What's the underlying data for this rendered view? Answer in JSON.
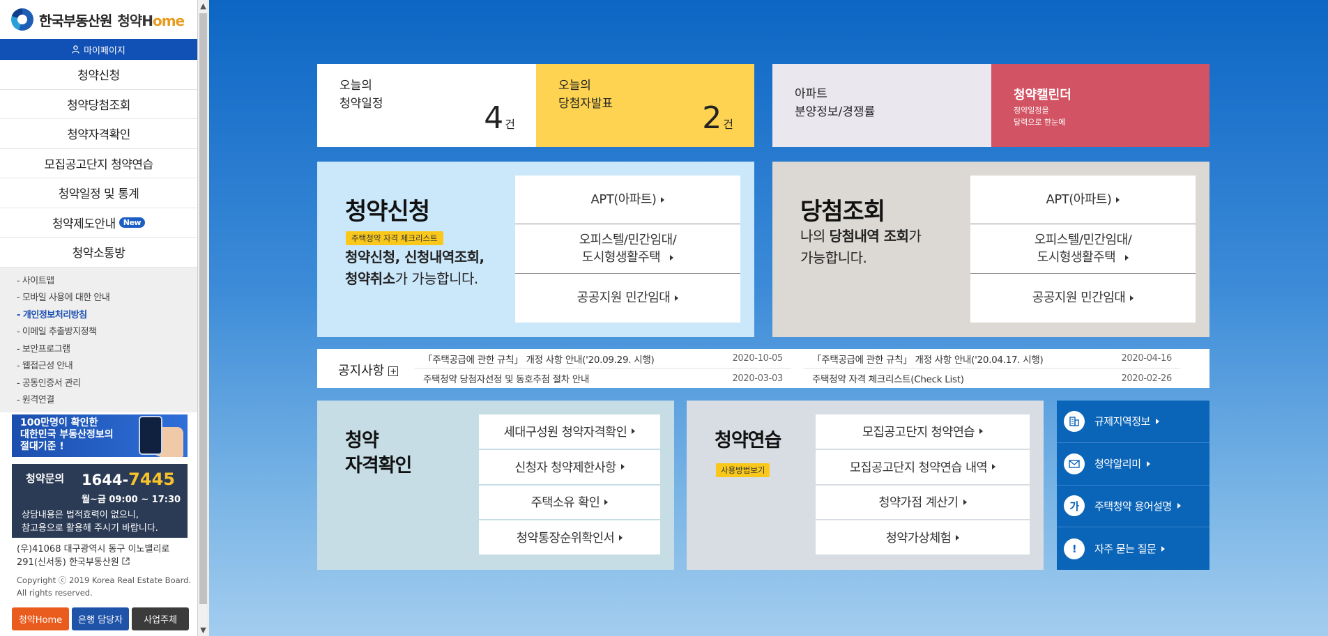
{
  "brand": {
    "name": "한국부동산원",
    "service": "청약H",
    "service_suffix": "ome"
  },
  "sidebar": {
    "mypage": "마이페이지",
    "nav": [
      "청약신청",
      "청약당첨조회",
      "청약자격확인",
      "모집공고단지 청약연습",
      "청약일정 및 통계",
      "청약제도안내",
      "청약소통방"
    ],
    "new_badge": "New",
    "sub_links": [
      "- 사이트맵",
      "- 모바일 사용에 대한 안내",
      "- 개인정보처리방침",
      "- 이메일 추출방지정책",
      "- 보안프로그램",
      "- 웹접근성 안내",
      "- 공동인증서 관리",
      "- 원격연결"
    ],
    "banner": {
      "line1": "100만명이 확인한",
      "line2": "대한민국 부동산정보의",
      "line3": "절대기준 !"
    },
    "inquiry": {
      "label": "청약문의",
      "phone_prefix": "1644-",
      "phone_suffix": "7445",
      "hours": "월~금 09:00 ~ 17:30",
      "note1": "상담내용은 법적효력이 없으니,",
      "note2": "참고용으로 활용해 주시기 바랍니다."
    },
    "address1": "(우)41068 대구광역시 동구 이노밸리로",
    "address2": "291(신서동) 한국부동산원",
    "copyright1": "Copyright ⓒ 2019 Korea Real Estate Board.",
    "copyright2": "All rights reserved.",
    "footer_buttons": [
      "청약Home",
      "은행 담당자",
      "사업주체"
    ]
  },
  "tiles": {
    "today_schedule": {
      "line1": "오늘의",
      "line2": "청약일정",
      "count": "4",
      "unit": "건"
    },
    "today_winner": {
      "line1": "오늘의",
      "line2": "당첨자발표",
      "count": "2",
      "unit": "건"
    },
    "apt_info": {
      "line1": "아파트",
      "line2": "분양정보/경쟁률"
    },
    "calendar": {
      "title": "청약캘린더",
      "desc1": "청약일정을",
      "desc2": "달력으로 한눈에"
    }
  },
  "apply": {
    "title": "청약신청",
    "tag": "주택청약 자격 체크리스트",
    "desc1_bold": "청약신청, 신청내역조회,",
    "desc2_bold": "청약취소",
    "desc2_rest": "가 가능합니다.",
    "links": {
      "apt": "APT(아파트)",
      "officetel1": "오피스텔/민간임대/",
      "officetel2": "도시형생활주택",
      "public": "공공지원 민간임대"
    }
  },
  "winner": {
    "title": "당첨조회",
    "desc1_pre": "나의 ",
    "desc1_bold": "당첨내역 조회",
    "desc1_post": "가",
    "desc2": "가능합니다.",
    "links": {
      "apt": "APT(아파트)",
      "officetel1": "오피스텔/민간임대/",
      "officetel2": "도시형생활주택",
      "public": "공공지원 민간임대"
    }
  },
  "notice": {
    "title": "공지사항",
    "plus": "+",
    "left": [
      {
        "text": "「주택공급에 관한 규칙」 개정 사항 안내('20.09.29. 시행)",
        "date": "2020-10-05"
      },
      {
        "text": "주택청약 당첨자선정 및 동호추첨 절차 안내",
        "date": "2020-03-03"
      }
    ],
    "right": [
      {
        "text": "「주택공급에 관한 규칙」 개정 사항 안내('20.04.17. 시행)",
        "date": "2020-04-16"
      },
      {
        "text": "주택청약 자격 체크리스트(Check List)",
        "date": "2020-02-26"
      }
    ]
  },
  "qualification": {
    "title1": "청약",
    "title2": "자격확인",
    "links": [
      "세대구성원 청약자격확인",
      "신청자 청약제한사항",
      "주택소유 확인",
      "청약통장순위확인서"
    ]
  },
  "practice": {
    "title": "청약연습",
    "tag": "사용방법보기",
    "links": [
      "모집공고단지 청약연습",
      "모집공고단지 청약연습 내역",
      "청약가점 계산기",
      "청약가상체험"
    ]
  },
  "quick": [
    {
      "icon": "building-icon",
      "label": "규제지역정보"
    },
    {
      "icon": "mail-icon",
      "label": "청약알리미"
    },
    {
      "icon": "ga-glyph-icon",
      "label": "주택청약 용어설명"
    },
    {
      "icon": "exclamation-icon",
      "label": "자주 묻는 질문"
    }
  ]
}
